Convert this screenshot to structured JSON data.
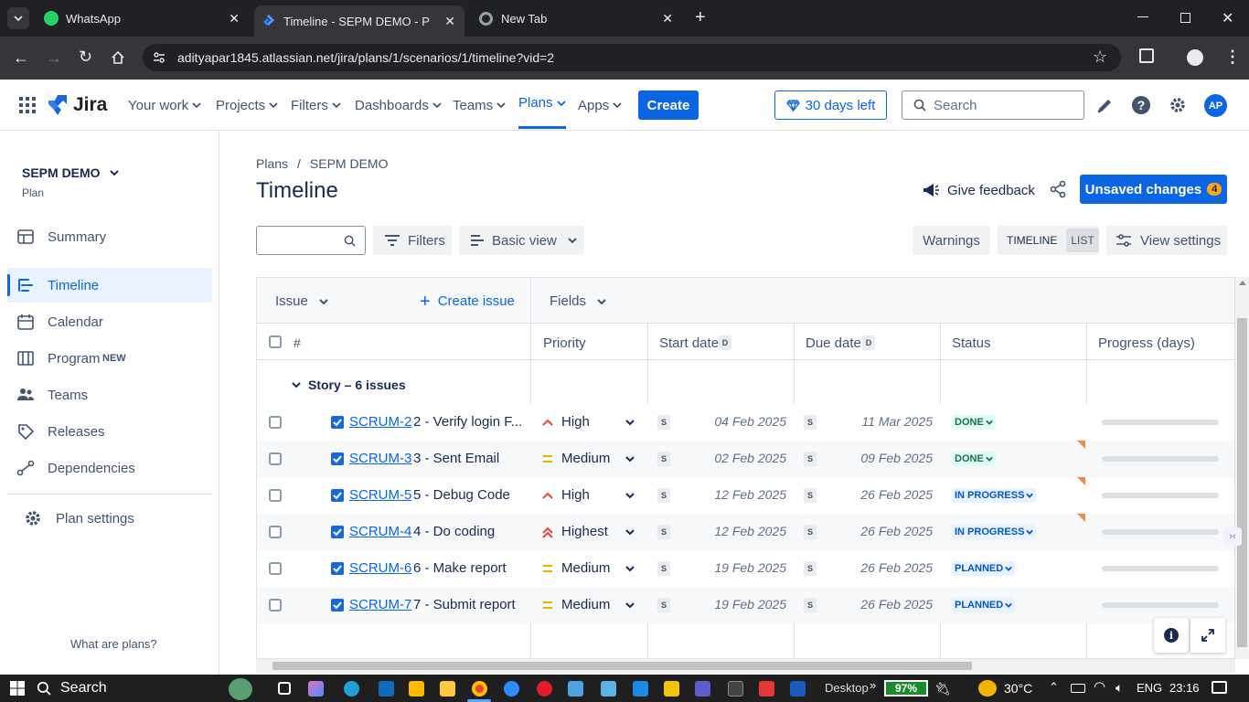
{
  "browser": {
    "tabs": [
      {
        "title": "WhatsApp"
      },
      {
        "title": "Timeline - SEPM DEMO - Plans"
      },
      {
        "title": "New Tab"
      }
    ],
    "url": "adityapar1845.atlassian.net/jira/plans/1/scenarios/1/timeline?vid=2"
  },
  "topnav": {
    "logo": "Jira",
    "items": [
      "Your work",
      "Projects",
      "Filters",
      "Dashboards",
      "Teams",
      "Plans",
      "Apps"
    ],
    "create": "Create",
    "trial": "30 days left",
    "search_placeholder": "Search",
    "avatar": "AP"
  },
  "sidebar": {
    "project": "SEPM DEMO",
    "subtitle": "Plan",
    "items": [
      {
        "label": "Summary",
        "icon": "summary-icon"
      },
      {
        "label": "Timeline",
        "icon": "timeline-icon"
      },
      {
        "label": "Calendar",
        "icon": "calendar-icon"
      },
      {
        "label": "Program",
        "icon": "program-icon",
        "badge": "NEW"
      },
      {
        "label": "Teams",
        "icon": "teams-icon"
      },
      {
        "label": "Releases",
        "icon": "releases-icon"
      },
      {
        "label": "Dependencies",
        "icon": "dependencies-icon"
      }
    ],
    "settings": "Plan settings",
    "footer": "What are plans?"
  },
  "main": {
    "breadcrumb": [
      "Plans",
      "/",
      "SEPM DEMO"
    ],
    "title": "Timeline",
    "feedback": "Give feedback",
    "unsaved": "Unsaved changes",
    "unsaved_count": "4",
    "filters": "Filters",
    "basic_view": "Basic view",
    "warnings": "Warnings",
    "toggle_timeline": "TIMELINE",
    "toggle_list": "LIST",
    "view_settings": "View settings"
  },
  "table": {
    "issue_header": "Issue",
    "create_issue": "Create issue",
    "fields": "Fields",
    "columns": {
      "num": "#",
      "priority": "Priority",
      "start": "Start date",
      "due": "Due date",
      "status": "Status",
      "progress": "Progress (days)",
      "date_badge": "D"
    },
    "group": "Story – 6 issues",
    "rows": [
      {
        "key": "SCRUM-2",
        "summary": "2 - Verify login F...",
        "priority": "High",
        "start": "04 Feb 2025",
        "due": "11 Mar 2025",
        "status": "DONE",
        "date_badge": "S"
      },
      {
        "key": "SCRUM-3",
        "summary": "3 - Sent Email",
        "priority": "Medium",
        "start": "02 Feb 2025",
        "due": "09 Feb 2025",
        "status": "DONE",
        "date_badge": "S"
      },
      {
        "key": "SCRUM-5",
        "summary": "5 - Debug Code",
        "priority": "High",
        "start": "12 Feb 2025",
        "due": "26 Feb 2025",
        "status": "IN PROGRESS",
        "date_badge": "S"
      },
      {
        "key": "SCRUM-4",
        "summary": "4 - Do coding",
        "priority": "Highest",
        "start": "12 Feb 2025",
        "due": "26 Feb 2025",
        "status": "IN PROGRESS",
        "date_badge": "S"
      },
      {
        "key": "SCRUM-6",
        "summary": "6 - Make report",
        "priority": "Medium",
        "start": "19 Feb 2025",
        "due": "26 Feb 2025",
        "status": "PLANNED",
        "date_badge": "S"
      },
      {
        "key": "SCRUM-7",
        "summary": "7 - Submit report",
        "priority": "Medium",
        "start": "19 Feb 2025",
        "due": "26 Feb 2025",
        "status": "PLANNED",
        "date_badge": "S"
      }
    ]
  },
  "taskbar": {
    "search": "Search",
    "desktop": "Desktop",
    "battery": "97%",
    "temp": "30°C",
    "lang": "ENG",
    "time": "23:16"
  },
  "colors": {
    "accent": "#0c66e4",
    "done": "#216e4e",
    "inprogress": "#0055cc",
    "planned": "#0055cc",
    "high": "#e2483d",
    "medium": "#e2b203"
  }
}
